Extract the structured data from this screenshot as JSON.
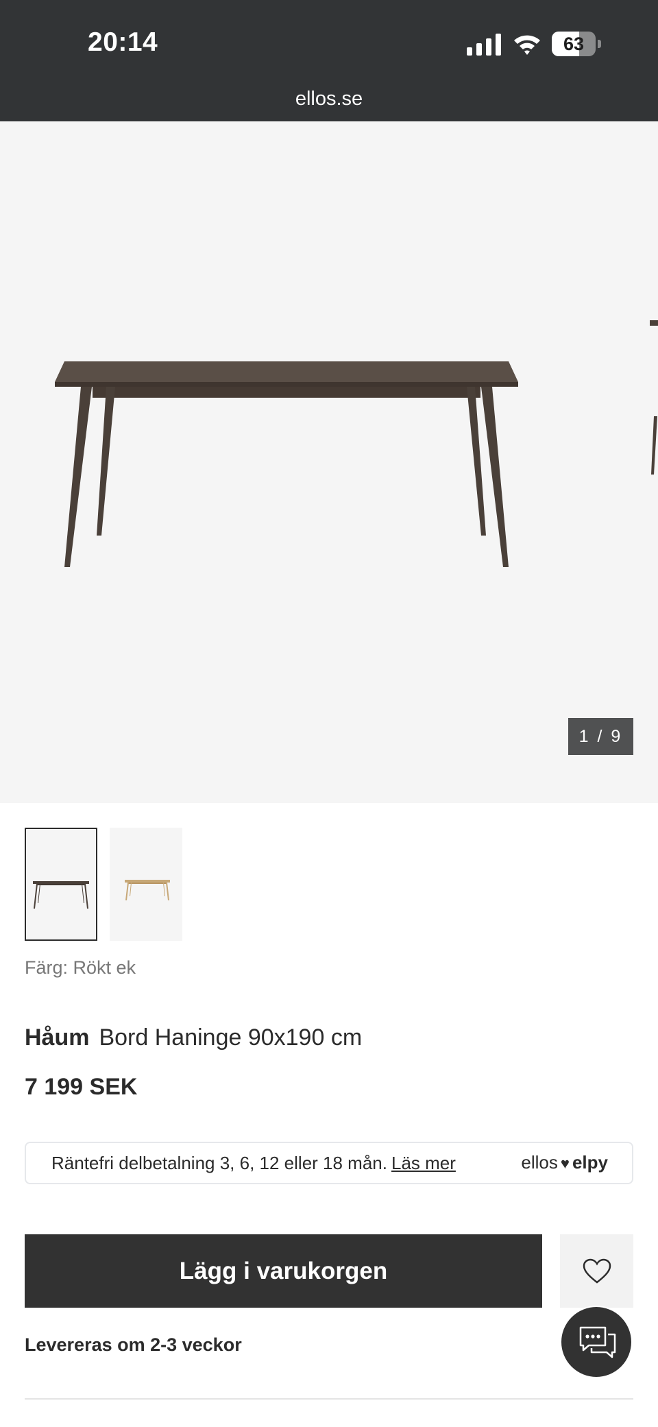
{
  "status_bar": {
    "time": "20:14",
    "battery_percent": 63
  },
  "browser": {
    "url": "ellos.se"
  },
  "gallery": {
    "counter": "1 / 9",
    "current_image": 1,
    "total_images": 9
  },
  "product": {
    "color_label": "Färg: Rökt ek",
    "brand": "Håum",
    "name": "Bord Haninge 90x190 cm",
    "price": "7 199 SEK"
  },
  "installment": {
    "text": "Räntefri delbetalning 3, 6, 12 eller 18 mån.",
    "link": "Läs mer",
    "logo_ellos": "ellos",
    "logo_elpy": "elpy"
  },
  "actions": {
    "add_to_cart": "Lägg i varukorgen",
    "delivery": "Levereras om 2-3 veckor"
  },
  "icons": {
    "favorite": "heart-icon",
    "chat": "chat-icon",
    "signal": "signal-icon",
    "wifi": "wifi-icon",
    "battery": "battery-icon"
  },
  "colors": {
    "topbar": "#323436",
    "button_dark": "#323232",
    "gallery_bg": "#f5f5f5",
    "text": "#2b2b2b",
    "table_dark": "#4a4039",
    "table_light": "#c7a878"
  }
}
